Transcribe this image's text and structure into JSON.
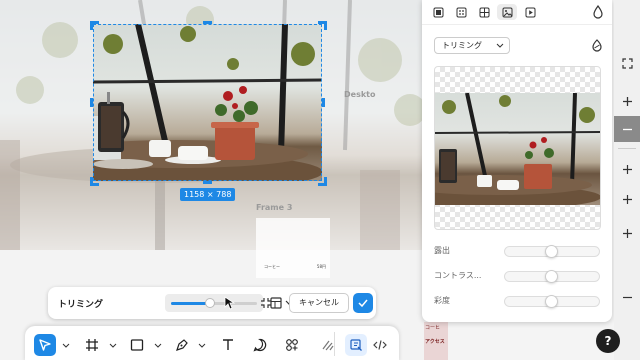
{
  "canvas": {
    "frame_label_desktop": "Deskto",
    "frame_label_3": "Frame 3",
    "crop_size_badge": "1158 × 788",
    "frame3_left_text": "コーヒー",
    "frame3_right_text": "58円",
    "strip_text_1": "コーヒ",
    "strip_text_2": "アクセス"
  },
  "trim_toolbar": {
    "label": "トリミング",
    "zoom_fraction": 0.45,
    "cancel_label": "キャンセル",
    "confirm_icon": "check-icon"
  },
  "tools": {
    "items": [
      "pointer-icon",
      "frame-icon",
      "rectangle-icon",
      "pen-icon",
      "text-icon",
      "comment-icon",
      "components-icon",
      "draw-icon",
      "design-mode-icon",
      "dev-mode-icon"
    ],
    "active": "pointer-icon"
  },
  "image_panel": {
    "tabs": [
      "layout-icon",
      "fill-icon",
      "grid-icon",
      "image-icon",
      "video-icon"
    ],
    "active_tab": "image-icon",
    "mode_label": "トリミング",
    "adjustments": [
      {
        "label": "露出",
        "value": 0.5
      },
      {
        "label": "コントラス...",
        "value": 0.5
      },
      {
        "label": "彩度",
        "value": 0.5
      }
    ]
  },
  "right_rail": {
    "help_label": "?"
  },
  "colors": {
    "accent": "#1e88e5",
    "panel_bg": "#ffffff"
  }
}
